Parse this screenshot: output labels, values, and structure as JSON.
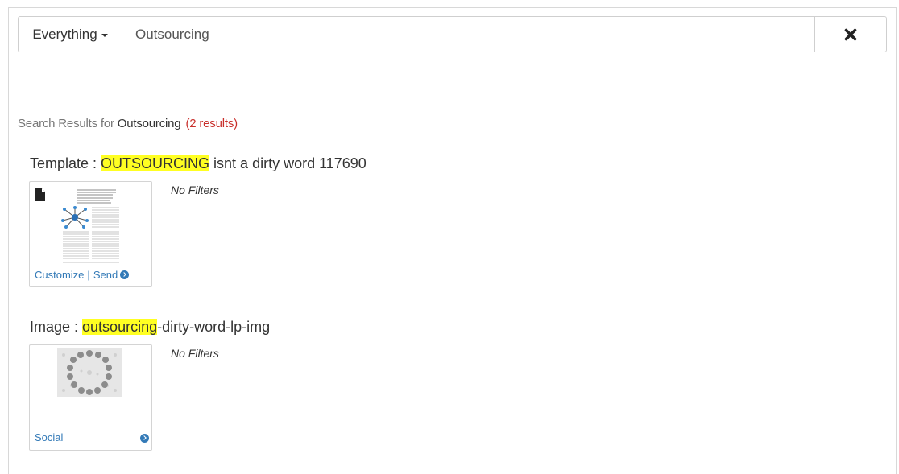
{
  "search": {
    "scope_label": "Everything",
    "query_value": "Outsourcing",
    "query_placeholder": ""
  },
  "summary": {
    "prefix": "Search Results for ",
    "term": "Outsourcing",
    "count": "(2 results)"
  },
  "results": [
    {
      "type_label": "Template : ",
      "highlight": "OUTSOURCING",
      "rest": " isnt a dirty word 117690",
      "filters": "No Filters",
      "thumb_icon": "file-icon",
      "actions": {
        "customize": "Customize",
        "separator": "|",
        "send": "Send"
      }
    },
    {
      "type_label": "Image : ",
      "highlight": "outsourcing",
      "rest": "-dirty-word-lp-img",
      "filters": "No Filters",
      "actions": {
        "social": "Social"
      }
    }
  ],
  "colors": {
    "highlight": "#ffff22",
    "link": "#337ab7",
    "count": "#c9302c"
  }
}
